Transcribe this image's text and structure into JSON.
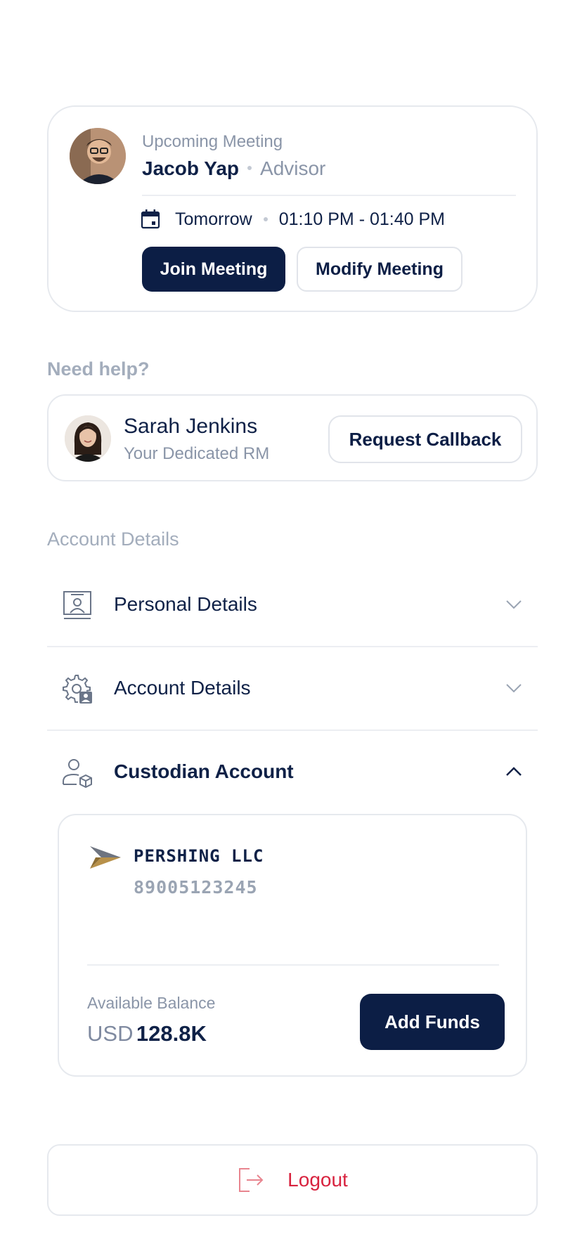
{
  "meeting": {
    "label": "Upcoming Meeting",
    "advisor_name": "Jacob Yap",
    "advisor_role": "Advisor",
    "day": "Tomorrow",
    "time": "01:10 PM - 01:40 PM",
    "join_label": "Join Meeting",
    "modify_label": "Modify Meeting"
  },
  "help": {
    "title": "Need help?",
    "rm_name": "Sarah Jenkins",
    "rm_subtitle": "Your Dedicated RM",
    "callback_label": "Request Callback"
  },
  "account": {
    "title": "Account Details",
    "rows": [
      {
        "label": "Personal Details",
        "icon": "id-card-icon",
        "expanded": false
      },
      {
        "label": "Account Details",
        "icon": "gear-user-icon",
        "expanded": false
      },
      {
        "label": "Custodian Account",
        "icon": "user-box-icon",
        "expanded": true
      }
    ]
  },
  "custodian": {
    "name": "PERSHING LLC",
    "account_number": "89005123245",
    "balance_label": "Available Balance",
    "currency": "USD",
    "amount": "128.8K",
    "add_funds_label": "Add Funds"
  },
  "logout": {
    "label": "Logout"
  },
  "colors": {
    "navy": "#0c1e45",
    "muted": "#8a95a8",
    "danger": "#d8233f",
    "border": "#e6e9ee"
  }
}
